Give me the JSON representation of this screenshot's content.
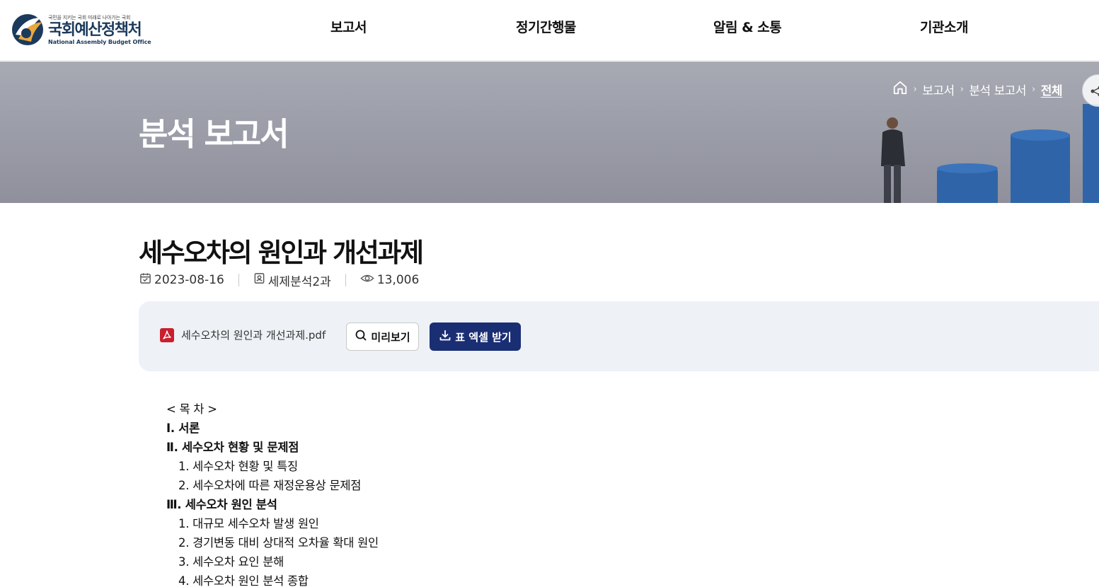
{
  "header": {
    "logo": {
      "tagline": "국민을 지키는 국회 미래로 나아가는 국회",
      "name": "국회예산정책처",
      "english": "National Assembly Budget Office"
    },
    "nav": [
      {
        "label": "보고서"
      },
      {
        "label": "정기간행물"
      },
      {
        "label": "알림 & 소통"
      },
      {
        "label": "기관소개"
      }
    ]
  },
  "banner": {
    "title": "분석 보고서",
    "breadcrumb": {
      "home_icon": "home-icon",
      "items": [
        "보고서",
        "분석 보고서"
      ],
      "current": "전체",
      "separator": "›"
    },
    "share_icon": "share-icon"
  },
  "article": {
    "title": "세수오차의 원인과 개선과제",
    "meta": {
      "date": "2023-08-16",
      "department": "세제분석2과",
      "views": "13,006"
    },
    "file": {
      "name": "세수오차의 원인과 개선과제.pdf",
      "preview_label": "미리보기",
      "excel_label": "표 엑셀 받기"
    },
    "toc": [
      {
        "text": "< 목 차 >",
        "style": "n"
      },
      {
        "text": " Ⅰ. 서론",
        "style": "b"
      },
      {
        "text": " Ⅱ. 세수오차 현황 및 문제점",
        "style": "b"
      },
      {
        "text": "1. 세수오차 현황 및 특징",
        "style": "s"
      },
      {
        "text": "2. 세수오차에 따른 재정운용상 문제점",
        "style": "s"
      },
      {
        "text": "Ⅲ. 세수오차 원인 분석",
        "style": "b"
      },
      {
        "text": "1. 대규모 세수오차 발생 원인",
        "style": "s"
      },
      {
        "text": "2. 경기변동 대비 상대적 오차율 확대 원인",
        "style": "s"
      },
      {
        "text": "3. 세수오차 요인 분해",
        "style": "s"
      },
      {
        "text": "4. 세수오차 원인 분석 종합",
        "style": "s"
      }
    ]
  },
  "colors": {
    "brand_navy": "#1a2e74",
    "logo_blue": "#1b3a5c",
    "pdf_red": "#c8202f",
    "file_box_bg": "#eef1f6"
  }
}
